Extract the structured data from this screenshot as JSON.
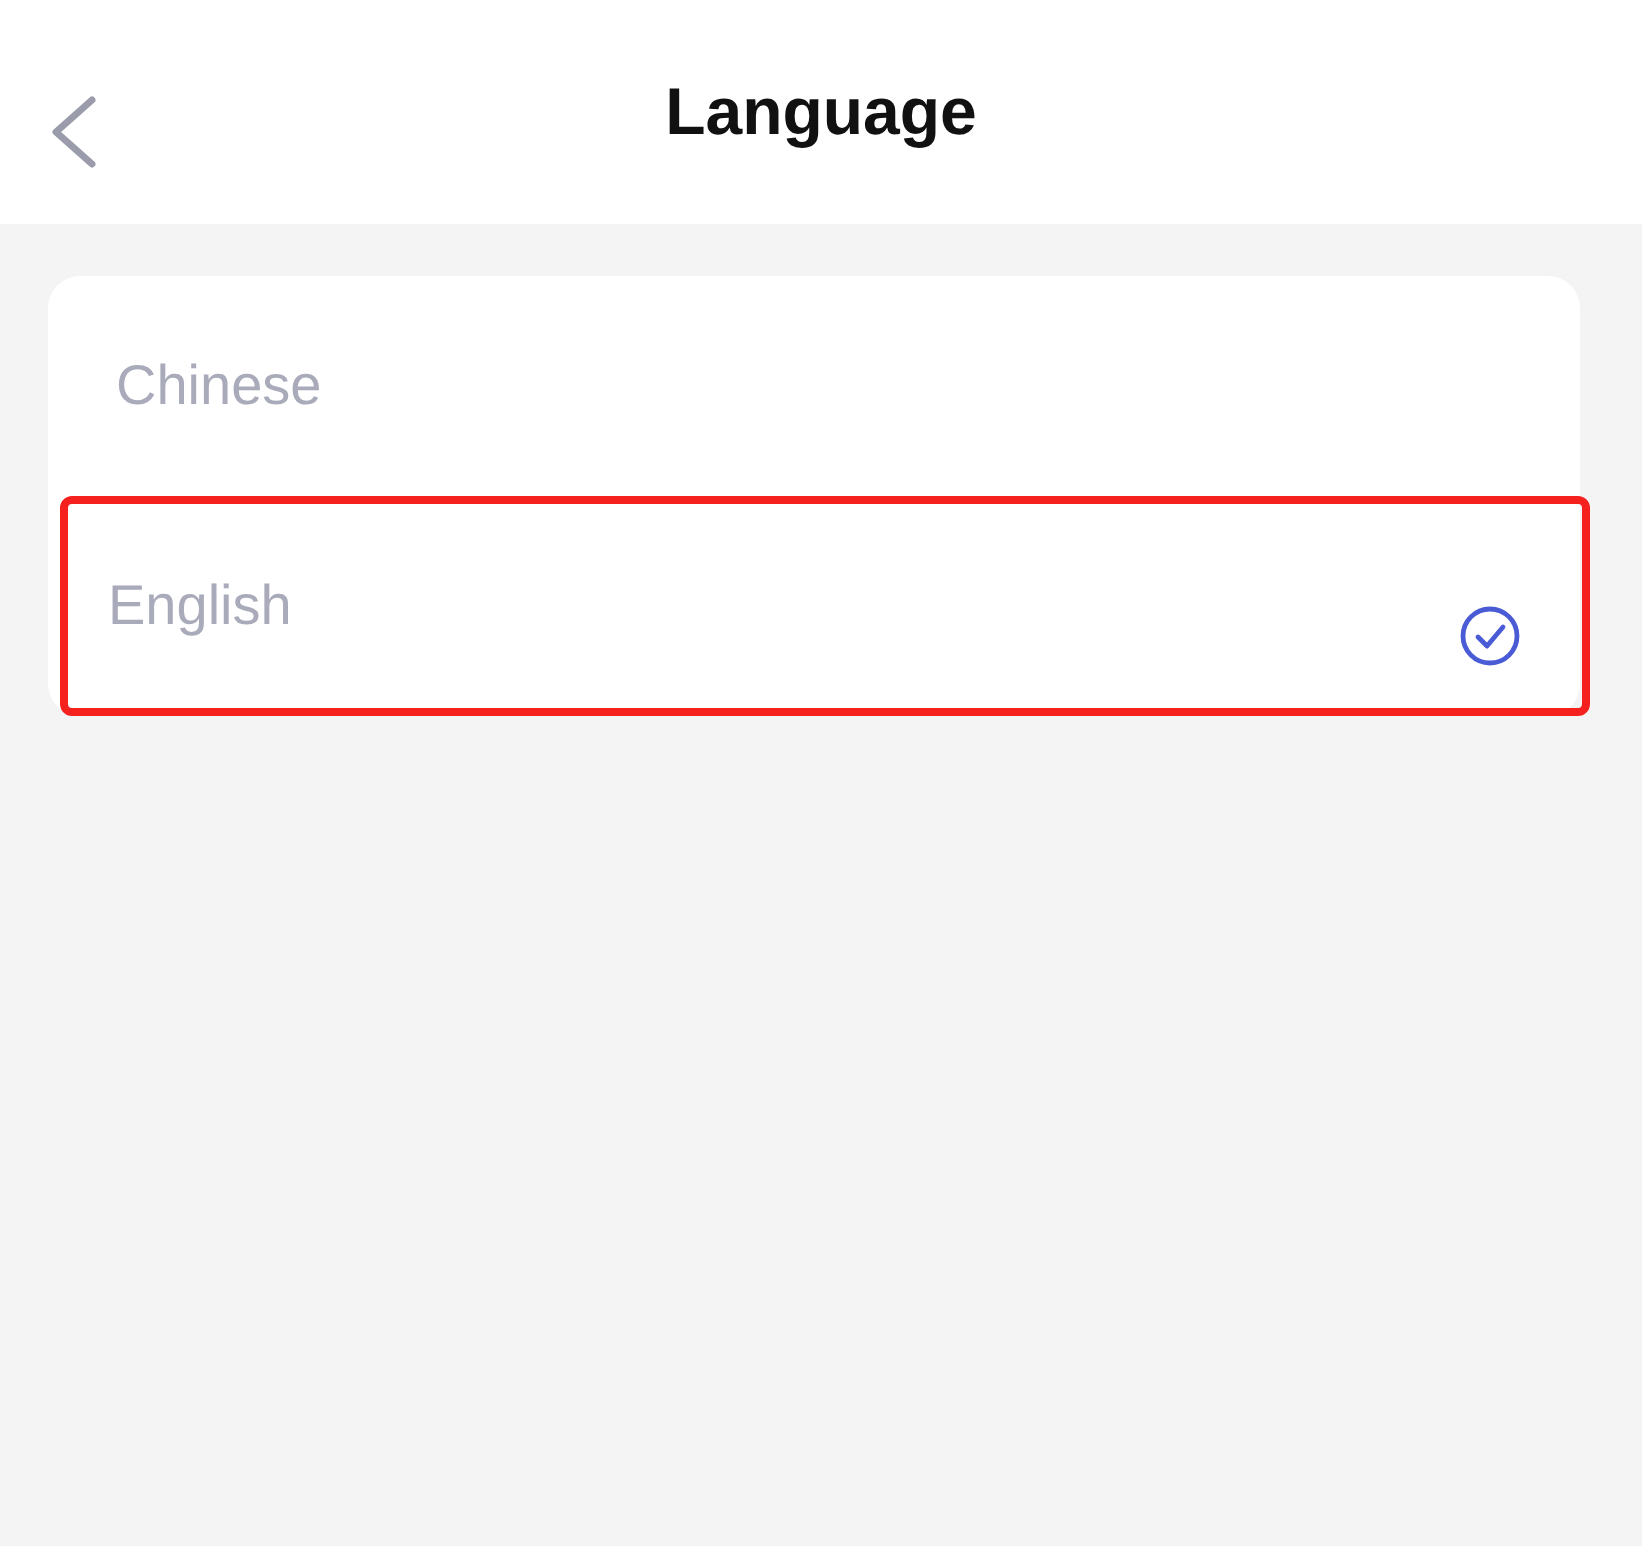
{
  "header": {
    "title": "Language"
  },
  "languages": [
    {
      "label": "Chinese",
      "selected": false,
      "highlighted": false
    },
    {
      "label": "English",
      "selected": true,
      "highlighted": true
    }
  ]
}
